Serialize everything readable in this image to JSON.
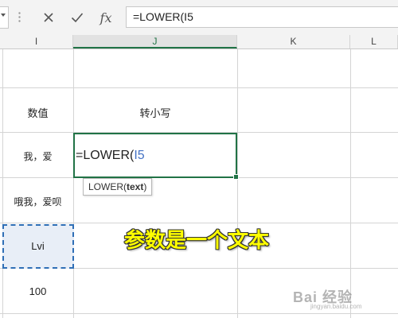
{
  "formula_bar": {
    "cancel_icon": "close-icon",
    "confirm_icon": "check-icon",
    "fx_label": "fx",
    "formula": "=LOWER(I5"
  },
  "columns": [
    "I",
    "J",
    "K",
    "L"
  ],
  "active_column": "J",
  "cells": {
    "i4": "数值",
    "j4": "转小写",
    "i5": "我，爱",
    "i6": "哦我，爱呗",
    "i7": "Lvi",
    "i8": "100"
  },
  "editing": {
    "prefix": "=LOWER(",
    "ref": "I5"
  },
  "tooltip": {
    "func": "LOWER(",
    "arg": "text",
    "close": ")"
  },
  "annotation": "参数是一个文本",
  "watermark": {
    "brand": "Bai 经验",
    "url": "jingyan.baidu.com"
  },
  "colors": {
    "accent": "#217346",
    "ref_blue": "#4472c4",
    "annotation_fill": "#ffff00"
  }
}
